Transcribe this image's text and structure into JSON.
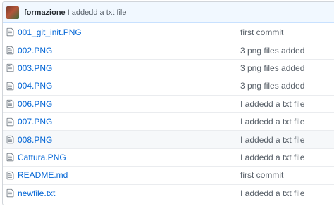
{
  "commit_tease": {
    "author": "formazione",
    "message": "I addedd a txt file"
  },
  "files": [
    {
      "name": "001_git_init.PNG",
      "commit": "first commit",
      "icon": "file-icon"
    },
    {
      "name": "002.PNG",
      "commit": "3 png files added",
      "icon": "file-icon"
    },
    {
      "name": "003.PNG",
      "commit": "3 png files added",
      "icon": "file-icon"
    },
    {
      "name": "004.PNG",
      "commit": "3 png files added",
      "icon": "file-icon"
    },
    {
      "name": "006.PNG",
      "commit": "I addedd a txt file",
      "icon": "file-icon"
    },
    {
      "name": "007.PNG",
      "commit": "I addedd a txt file",
      "icon": "file-icon"
    },
    {
      "name": "008.PNG",
      "commit": "I addedd a txt file",
      "icon": "file-icon"
    },
    {
      "name": "Cattura.PNG",
      "commit": "I addedd a txt file",
      "icon": "file-icon"
    },
    {
      "name": "README.md",
      "commit": "first commit",
      "icon": "file-icon"
    },
    {
      "name": "newfile.txt",
      "commit": "I addedd a txt file",
      "icon": "file-icon"
    }
  ],
  "colors": {
    "link": "#0366d6",
    "muted": "#586069",
    "header_bg": "#f1f8ff",
    "hover_bg": "#f6f8fa",
    "border": "#d1d5da"
  }
}
